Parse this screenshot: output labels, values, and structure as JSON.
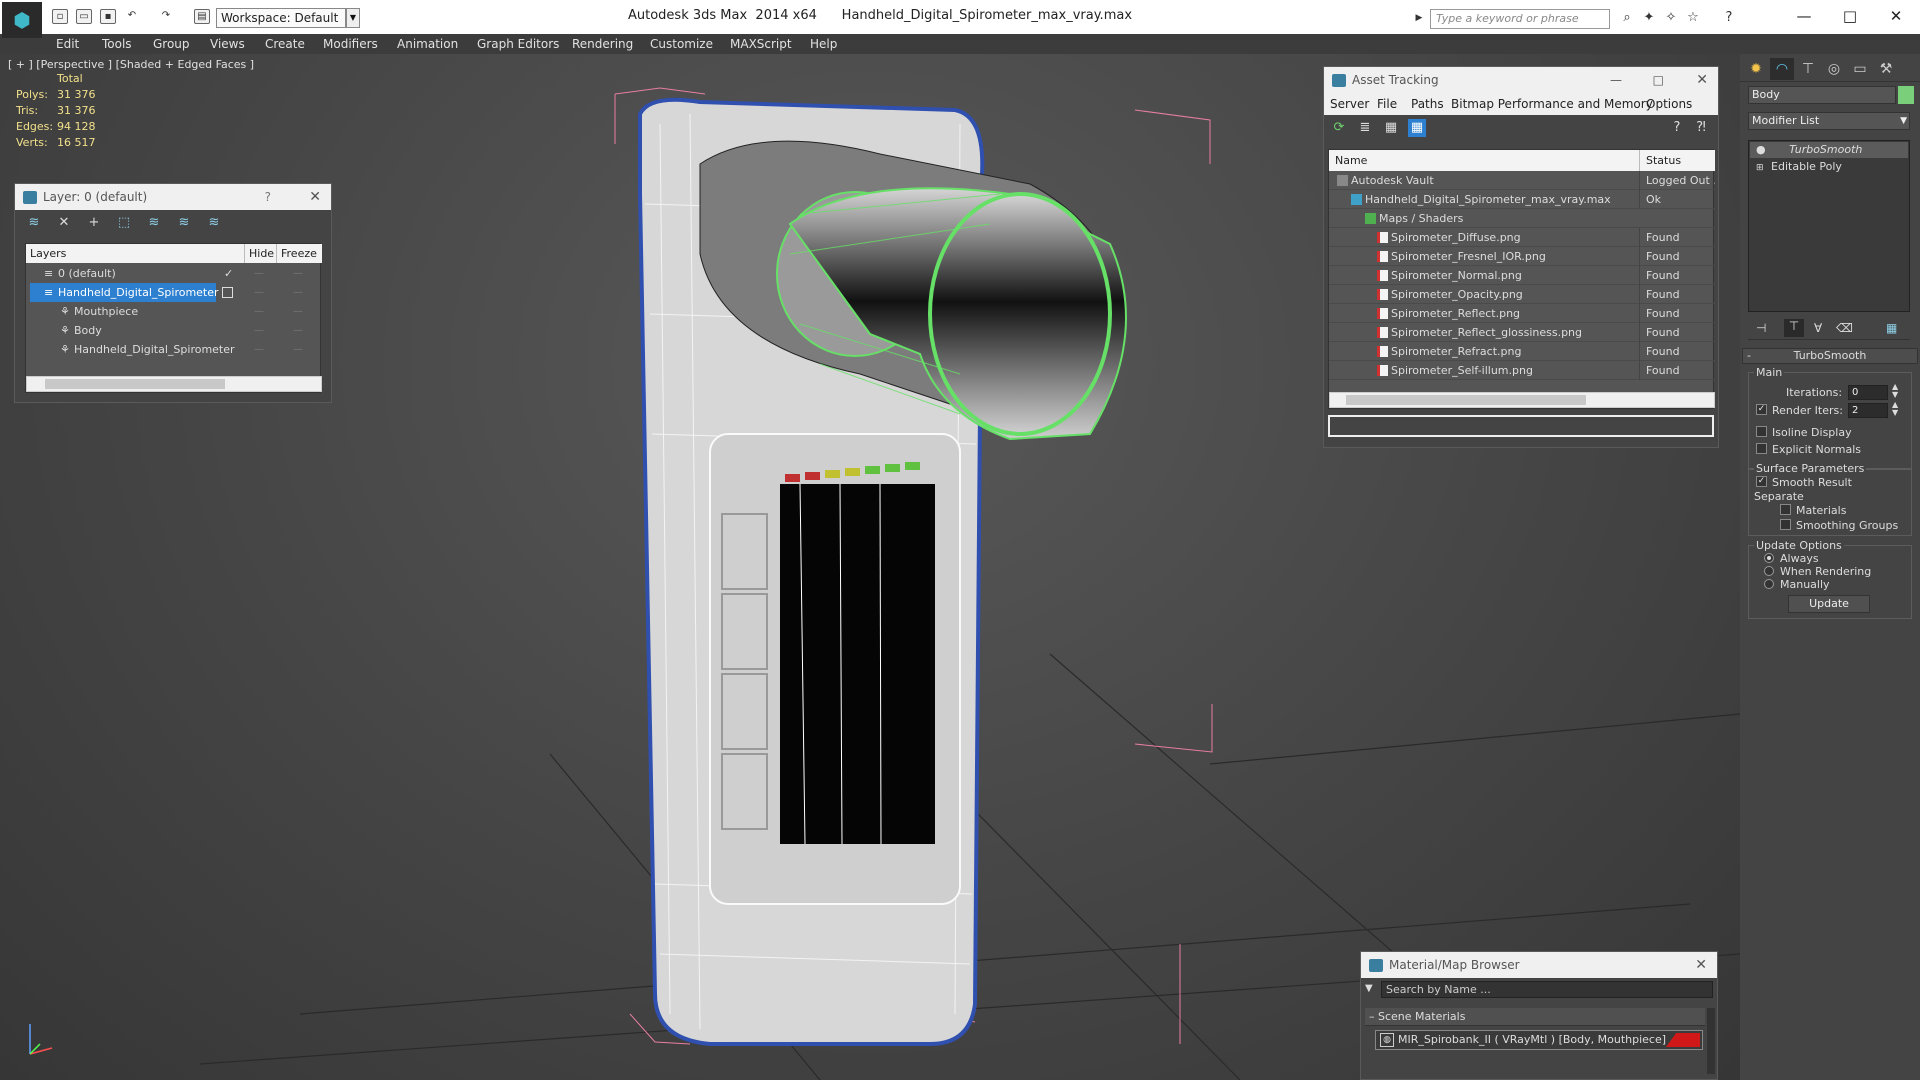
{
  "titlebar": {
    "workspace": "Workspace: Default",
    "app_title": "Autodesk 3ds Max  2014 x64      Handheld_Digital_Spirometer_max_vray.max",
    "search_placeholder": "Type a keyword or phrase"
  },
  "menu": [
    "Edit",
    "Tools",
    "Group",
    "Views",
    "Create",
    "Modifiers",
    "Animation",
    "Graph Editors",
    "Rendering",
    "Customize",
    "MAXScript",
    "Help"
  ],
  "viewport": {
    "label": "[ + ] [Perspective ] [Shaded + Edged Faces ]",
    "stats": {
      "header": "Total",
      "polys_label": "Polys:",
      "polys": "31 376",
      "tris_label": "Tris:",
      "tris": "31 376",
      "edges_label": "Edges:",
      "edges": "94 128",
      "verts_label": "Verts:",
      "verts": "16 517"
    }
  },
  "layer_panel": {
    "title": "Layer: 0 (default)",
    "help": "?",
    "col_layers": "Layers",
    "col_hide": "Hide",
    "col_freeze": "Freeze",
    "rows": [
      {
        "name": "0 (default)"
      },
      {
        "name": "Handheld_Digital_Spirometer"
      },
      {
        "name": "Mouthpiece"
      },
      {
        "name": "Body"
      },
      {
        "name": "Handheld_Digital_Spirometer"
      }
    ]
  },
  "asset_tracking": {
    "title": "Asset Tracking",
    "menu": [
      "Server",
      "File",
      "Paths",
      "Bitmap Performance and Memory",
      "Options"
    ],
    "col_name": "Name",
    "col_status": "Status",
    "rows": [
      {
        "name": "Autodesk Vault",
        "status": "Logged Out ..."
      },
      {
        "name": "Handheld_Digital_Spirometer_max_vray.max",
        "status": "Ok"
      },
      {
        "name": "Maps / Shaders",
        "status": ""
      },
      {
        "name": "Spirometer_Diffuse.png",
        "status": "Found"
      },
      {
        "name": "Spirometer_Fresnel_IOR.png",
        "status": "Found"
      },
      {
        "name": "Spirometer_Normal.png",
        "status": "Found"
      },
      {
        "name": "Spirometer_Opacity.png",
        "status": "Found"
      },
      {
        "name": "Spirometer_Reflect.png",
        "status": "Found"
      },
      {
        "name": "Spirometer_Reflect_glossiness.png",
        "status": "Found"
      },
      {
        "name": "Spirometer_Refract.png",
        "status": "Found"
      },
      {
        "name": "Spirometer_Self-illum.png",
        "status": "Found"
      }
    ]
  },
  "material_browser": {
    "title": "Material/Map Browser",
    "search_placeholder": "Search by Name ...",
    "section": "Scene Materials",
    "item": "MIR_Spirobank_II ( VRayMtl ) [Body, Mouthpiece]",
    "swatch_color": "#d01818"
  },
  "command_panel": {
    "object_name": "Body",
    "object_color": "#7ad07a",
    "modifier_list": "Modifier List",
    "stack": [
      "TurboSmooth",
      "Editable Poly"
    ],
    "rollout_title": "TurboSmooth",
    "main_label": "Main",
    "iterations_label": "Iterations:",
    "iterations": "0",
    "render_iters_label": "Render Iters:",
    "render_iters": "2",
    "render_iters_checked": true,
    "isoline_label": "Isoline Display",
    "explicit_label": "Explicit Normals",
    "surface_label": "Surface Parameters",
    "smooth_result_label": "Smooth Result",
    "smooth_result_checked": true,
    "separate_label": "Separate",
    "materials_label": "Materials",
    "smoothing_groups_label": "Smoothing Groups",
    "update_options_label": "Update Options",
    "always_label": "Always",
    "when_rendering_label": "When Rendering",
    "manually_label": "Manually",
    "update_button": "Update"
  },
  "colors": {
    "selection_blue": "#2d7fd0",
    "wire_green": "#66e066",
    "bbox_pink": "#e87fa0"
  }
}
